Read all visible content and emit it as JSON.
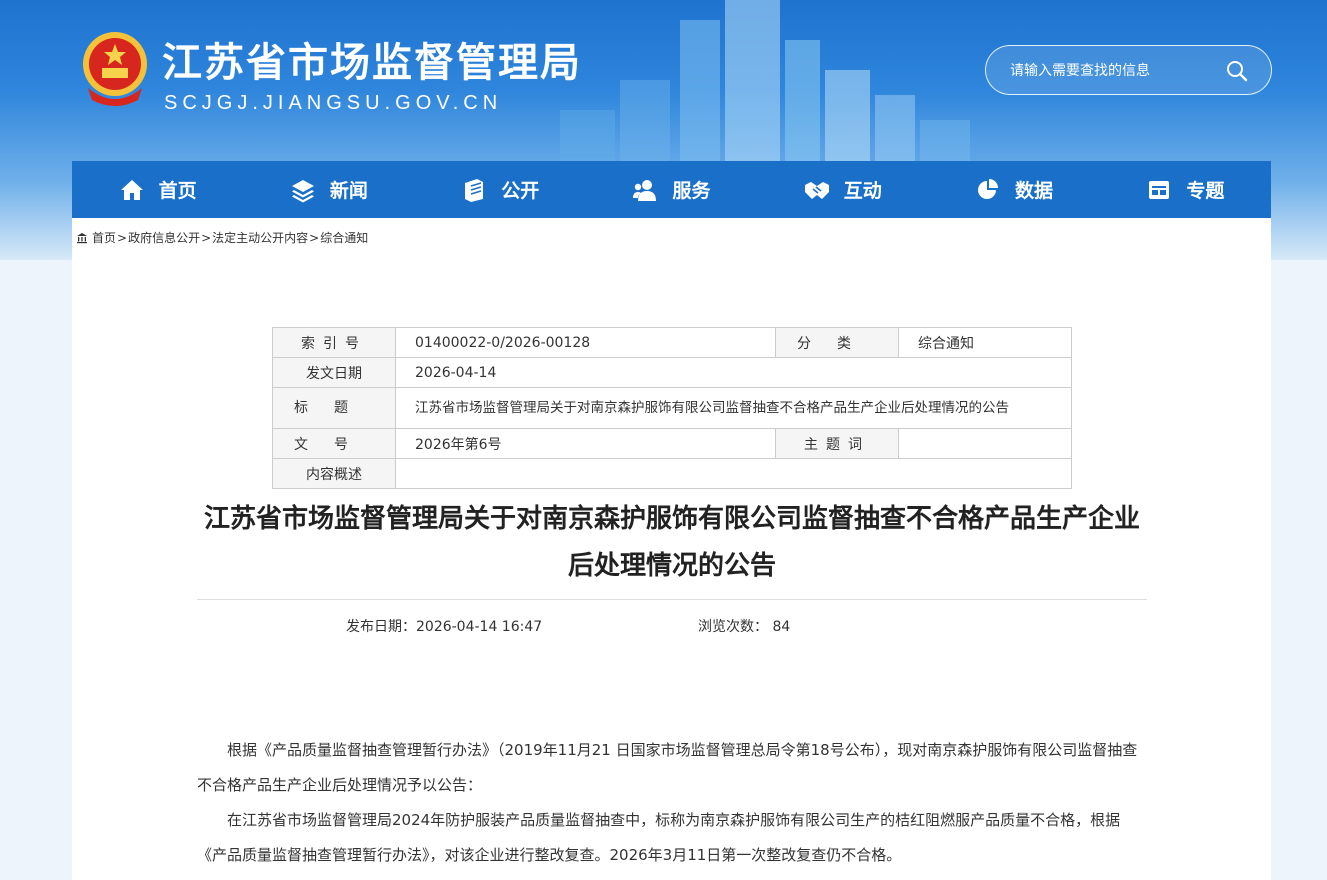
{
  "header": {
    "site_title": "江苏省市场监督管理局",
    "site_domain": "SCJGJ.JIANGSU.GOV.CN",
    "search_placeholder": "请输入需要查找的信息"
  },
  "nav": {
    "items": [
      {
        "label": "首页",
        "icon": "home-icon"
      },
      {
        "label": "新闻",
        "icon": "layers-icon"
      },
      {
        "label": "公开",
        "icon": "book-icon"
      },
      {
        "label": "服务",
        "icon": "users-icon"
      },
      {
        "label": "互动",
        "icon": "handshake-icon"
      },
      {
        "label": "数据",
        "icon": "pie-chart-icon"
      },
      {
        "label": "专题",
        "icon": "window-icon"
      }
    ]
  },
  "breadcrumb": {
    "items": [
      "首页",
      "政府信息公开",
      "法定主动公开内容",
      "综合通知"
    ],
    "separator": ">"
  },
  "info_table": {
    "index_label": "索引号",
    "index_value": "01400022-0/2026-00128",
    "category_label": "分类",
    "category_value": "综合通知",
    "date_label": "发文日期",
    "date_value": "2026-04-14",
    "title_label": "标题",
    "title_value": "江苏省市场监督管理局关于对南京森护服饰有限公司监督抽查不合格产品生产企业后处理情况的公告",
    "doc_no_label": "文号",
    "doc_no_value": "2026年第6号",
    "keywords_label": "主题词",
    "keywords_value": "",
    "summary_label": "内容概述",
    "summary_value": ""
  },
  "article": {
    "title": "江苏省市场监督管理局关于对南京森护服饰有限公司监督抽查不合格产品生产企业后处理情况的公告",
    "publish_label": "发布日期：",
    "publish_value": "2026-04-14 16:47",
    "views_label": "浏览次数：",
    "views_value": "84",
    "paragraphs": [
      "根据《产品质量监督抽查管理暂行办法》（2019年11月21 日国家市场监督管理总局令第18号公布），现对南京森护服饰有限公司监督抽查不合格产品生产企业后处理情况予以公告：",
      "在江苏省市场监督管理局2024年防护服装产品质量监督抽查中，标称为南京森护服饰有限公司生产的桔红阻燃服产品质量不合格，根据《产品质量监督抽查管理暂行办法》，对该企业进行整改复查。2026年3月11日第一次整改复查仍不合格。"
    ]
  },
  "colors": {
    "nav_bg": "#1a6fc8",
    "header_top": "#1e73cf"
  }
}
